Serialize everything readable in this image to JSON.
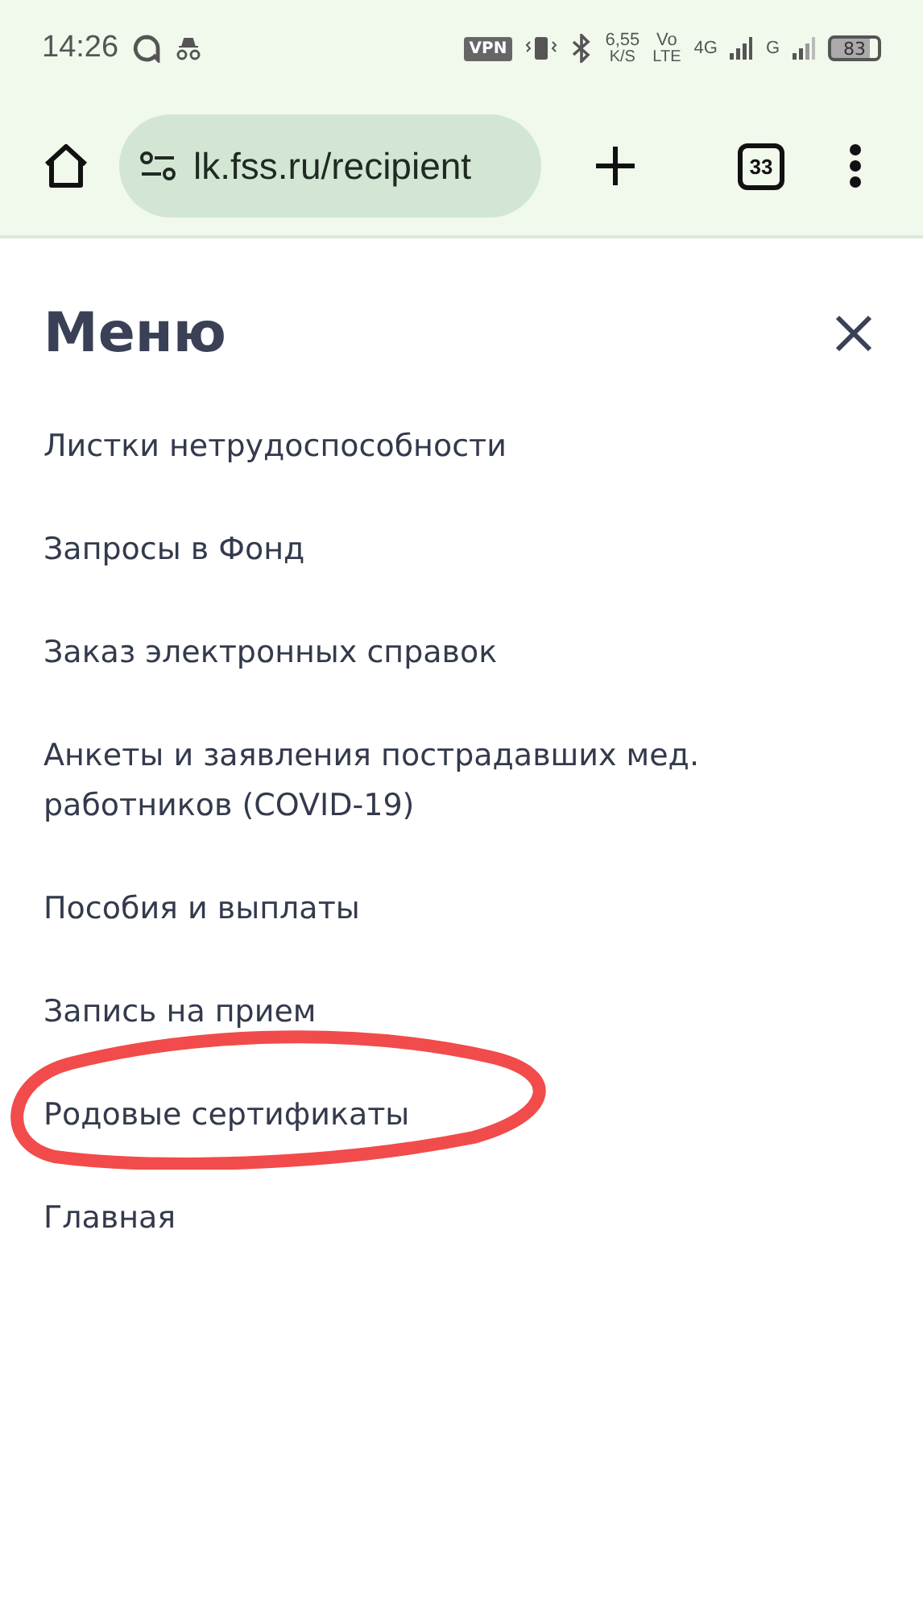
{
  "status_bar": {
    "time": "14:26",
    "vpn": "VPN",
    "speed": "6,55",
    "speed_unit": "K/S",
    "volte_top": "Vo",
    "volte_bottom": "LTE",
    "network": "4G",
    "network2": "G",
    "battery": "83"
  },
  "browser": {
    "url": "lk.fss.ru/recipient",
    "tab_count": "33"
  },
  "menu": {
    "title": "Меню",
    "items": [
      {
        "label": "Листки нетрудоспособности",
        "circled": false
      },
      {
        "label": "Запросы в Фонд",
        "circled": false
      },
      {
        "label": "Заказ электронных справок",
        "circled": false
      },
      {
        "label": "Анкеты и заявления пострадавших мед. работников (COVID-19)",
        "circled": false
      },
      {
        "label": "Пособия и выплаты",
        "circled": false
      },
      {
        "label": "Запись на прием",
        "circled": false
      },
      {
        "label": "Родовые сертификаты",
        "circled": true
      },
      {
        "label": "Главная",
        "circled": false
      }
    ]
  }
}
